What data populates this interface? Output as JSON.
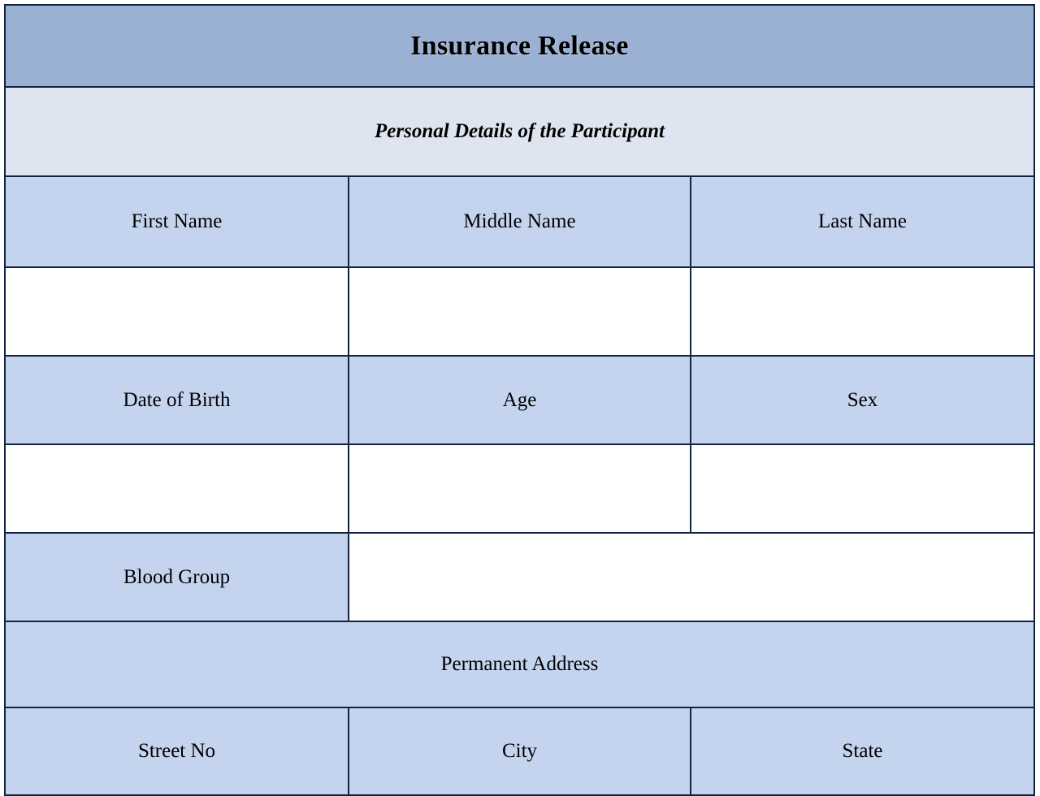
{
  "document": {
    "title": "Insurance Release",
    "section_heading": "Personal Details of the Participant"
  },
  "colors": {
    "title_bar": "#9BB1D4",
    "section_bar": "#DEE5F0",
    "label_cell": "#C5D4EE",
    "input_cell": "#FFFFFF",
    "border": "#13233F",
    "text": "#000000"
  },
  "rows": {
    "name_labels": {
      "first_name": "First Name",
      "middle_name": "Middle Name",
      "last_name": "Last Name"
    },
    "name_values": {
      "first_name": "",
      "middle_name": "",
      "last_name": ""
    },
    "demographic_labels": {
      "date_of_birth": "Date of Birth",
      "age": "Age",
      "sex": "Sex"
    },
    "demographic_values": {
      "date_of_birth": "",
      "age": "",
      "sex": ""
    },
    "blood_group": {
      "label": "Blood Group",
      "value": ""
    },
    "permanent_address": {
      "heading": "Permanent Address",
      "street_no": "Street No",
      "city": "City",
      "state": "State"
    }
  }
}
